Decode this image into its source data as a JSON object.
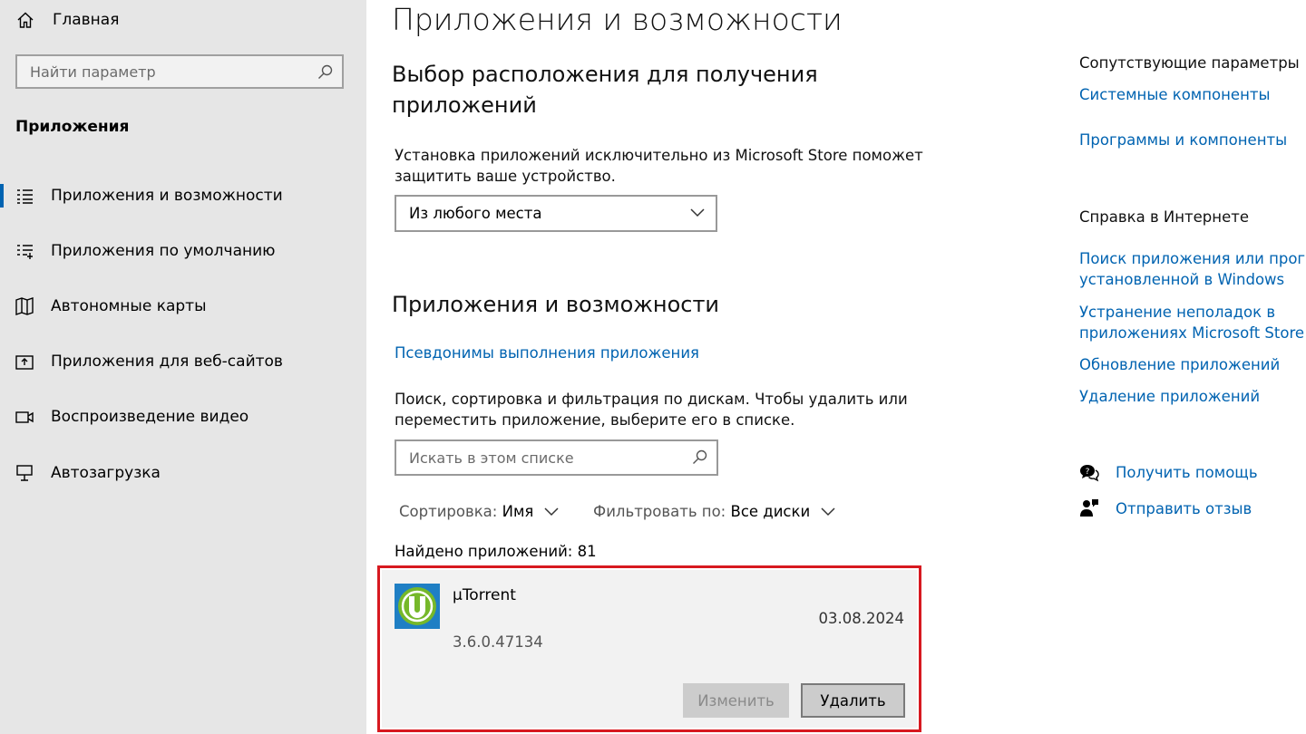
{
  "sidebar": {
    "home_label": "Главная",
    "search_placeholder": "Найти параметр",
    "section_title": "Приложения",
    "items": [
      {
        "label": "Приложения и возможности",
        "icon": "apps-list-icon",
        "active": true
      },
      {
        "label": "Приложения по умолчанию",
        "icon": "default-apps-icon"
      },
      {
        "label": "Автономные карты",
        "icon": "offline-maps-icon"
      },
      {
        "label": "Приложения для веб-сайтов",
        "icon": "web-apps-icon"
      },
      {
        "label": "Воспроизведение видео",
        "icon": "video-playback-icon"
      },
      {
        "label": "Автозагрузка",
        "icon": "startup-icon"
      }
    ]
  },
  "main": {
    "title": "Приложения и возможности",
    "install_section": {
      "heading_line1": "Выбор расположения для получения",
      "heading_line2": "приложений",
      "desc_line1": "Установка приложений исключительно из Microsoft Store поможет",
      "desc_line2": "защитить ваше устройство.",
      "dropdown_value": "Из любого места"
    },
    "apps_section": {
      "heading": "Приложения и возможности",
      "aliases_link": "Псевдонимы выполнения приложения",
      "desc_line1": "Поиск, сортировка и фильтрация по дискам. Чтобы удалить или",
      "desc_line2": "переместить приложение, выберите его в списке.",
      "search_placeholder": "Искать в этом списке",
      "sort_label": "Сортировка:",
      "sort_value": "Имя",
      "filter_label": "Фильтровать по:",
      "filter_value": "Все диски",
      "found_text": "Найдено приложений: 81"
    },
    "app": {
      "name": "µTorrent",
      "date": "03.08.2024",
      "version": "3.6.0.47134",
      "modify_label": "Изменить",
      "uninstall_label": "Удалить"
    },
    "colors": {
      "accent": "#0063b1",
      "highlight": "#d71920",
      "app_icon_bg": "#1f7fc4",
      "app_icon_logo": "#76b82a"
    }
  },
  "right": {
    "related_heading": "Сопутствующие параметры",
    "related_links": [
      "Системные компоненты",
      "Программы и компоненты"
    ],
    "web_help_heading": "Справка в Интернете",
    "web_links": [
      {
        "line1": "Поиск приложения или програ",
        "line2": "установленной в Windows"
      },
      {
        "line1": "Устранение неполадок в",
        "line2": "приложениях Microsoft Store"
      },
      {
        "line1": "Обновление приложений"
      },
      {
        "line1": "Удаление приложений"
      }
    ],
    "get_help": "Получить помощь",
    "send_feedback": "Отправить отзыв"
  }
}
